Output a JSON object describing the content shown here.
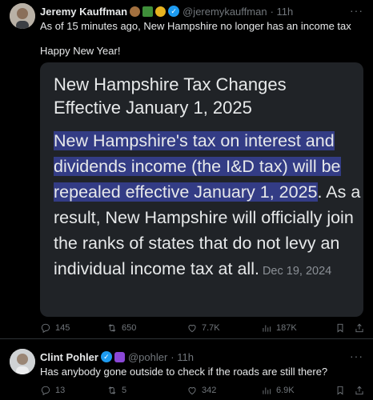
{
  "tweets": [
    {
      "author": "Jeremy Kauffman",
      "handle": "@jeremykauffman",
      "time": "· 11h",
      "text_line1": "As of 15 minutes ago, New Hampshire no longer has an income tax",
      "text_line2": "Happy New Year!",
      "badges": [
        "bear-emoji-icon",
        "tree-emoji-icon",
        "gold-emoji-icon",
        "verified-badge-icon"
      ],
      "card": {
        "title_line1": "New Hampshire Tax Changes",
        "title_line2": "Effective January 1, 2025",
        "highlight": "New Hampshire's tax on interest and dividends income (the I&D tax) will be repealed effective January 1, 2025",
        "body": ". As a result, New Hampshire will officially join the ranks of states that do not levy an individual income tax at all.",
        "date": "Dec 19, 2024"
      },
      "stats": {
        "replies": "145",
        "retweets": "650",
        "likes": "7.7K",
        "views": "187K"
      }
    },
    {
      "author": "Clint Pohler",
      "handle": "@pohler",
      "time": "· 11h",
      "text": "Has anybody gone outside to check if the roads are still there?",
      "badges": [
        "verified-badge-icon",
        "people-emoji-icon"
      ],
      "stats": {
        "replies": "13",
        "retweets": "5",
        "likes": "342",
        "views": "6.9K"
      }
    }
  ],
  "colors": {
    "background": "#000000",
    "accent": "#1d9bf0",
    "highlight": "#333c85",
    "muted": "#71767b"
  }
}
